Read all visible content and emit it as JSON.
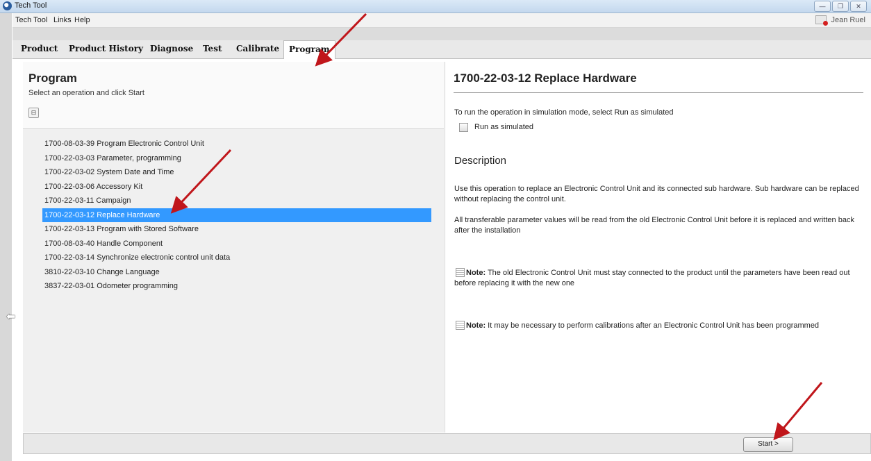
{
  "window": {
    "title": "Tech Tool",
    "buttons": [
      "minimize-icon",
      "restore-icon",
      "close-icon"
    ]
  },
  "menubar": {
    "items": [
      "Tech Tool",
      "Links",
      "Help"
    ],
    "user": "Jean Ruel"
  },
  "tabs": [
    "Product",
    "Product History",
    "Diagnose",
    "Test",
    "Calibrate",
    "Program"
  ],
  "active_tab": "Program",
  "left": {
    "title": "Program",
    "subtitle": "Select an operation and click Start",
    "operations": [
      "1700-08-03-39 Program Electronic Control Unit",
      "1700-22-03-03 Parameter, programming",
      "1700-22-03-02 System Date and Time",
      "1700-22-03-06 Accessory Kit",
      "1700-22-03-11 Campaign",
      "1700-22-03-12 Replace Hardware",
      "1700-22-03-13 Program with Stored Software",
      "1700-08-03-40 Handle Component",
      "1700-22-03-14 Synchronize electronic control unit data",
      "3810-22-03-10 Change Language",
      "3837-22-03-01 Odometer programming"
    ],
    "selected_index": 5
  },
  "right": {
    "title": "1700-22-03-12 Replace Hardware",
    "sim_instruction": "To run the operation in simulation mode, select Run as simulated",
    "sim_checkbox_label": "Run as simulated",
    "description_heading": "Description",
    "desc_p1": "Use this operation to replace an Electronic Control Unit and its connected sub hardware. Sub hardware can be replaced without replacing the control unit.",
    "desc_p2": "All transferable parameter values will be read from the old Electronic Control Unit before it is replaced and written back after the installation",
    "note_label": "Note:",
    "note1": " The old Electronic Control Unit must stay connected to the product until the parameters have been read out before replacing it with the new one",
    "note2": " It may be necessary to perform calibrations after an Electronic Control Unit has been programmed"
  },
  "footer": {
    "start_label": "Start >"
  },
  "colors": {
    "selection": "#3399ff",
    "annotation_arrow": "#c0161b"
  }
}
